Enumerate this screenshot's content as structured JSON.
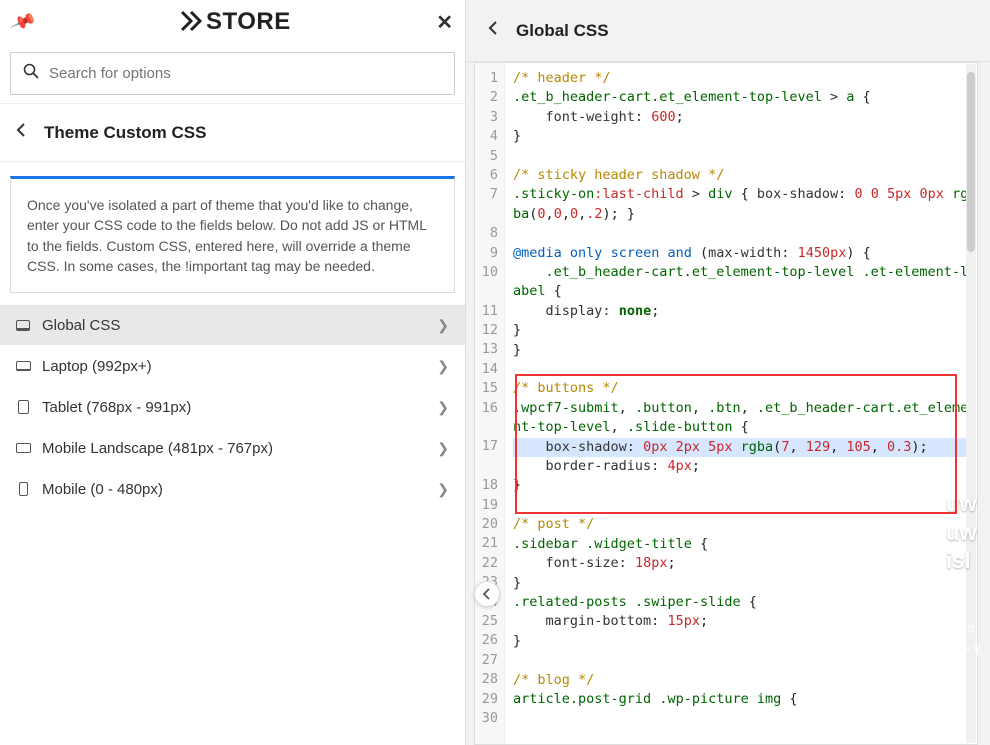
{
  "header": {
    "logo_prefix": "X",
    "logo_text": "STORE"
  },
  "search": {
    "placeholder": "Search for options"
  },
  "title": "Theme Custom CSS",
  "hint": "Once you've isolated a part of theme that you'd like to change, enter your CSS code to the fields below. Do not add JS or HTML to the fields. Custom CSS, entered here, will override a theme CSS. In some cases, the !important tag may be needed.",
  "menu": [
    {
      "label": "Global CSS",
      "active": true
    },
    {
      "label": "Laptop (992px+)",
      "active": false
    },
    {
      "label": "Tablet (768px - 991px)",
      "active": false
    },
    {
      "label": "Mobile Landscape (481px - 767px)",
      "active": false
    },
    {
      "label": "Mobile (0 - 480px)",
      "active": false
    }
  ],
  "right_title": "Global CSS",
  "code_lines": [
    {
      "n": 1,
      "html": "<span class='cm'>/* header */</span>"
    },
    {
      "n": 2,
      "html": "<span class='sel'>.et_b_header-cart.et_element-top-level</span> <span class='op'>&gt;</span> <span class='sel'>a</span> {"
    },
    {
      "n": 3,
      "html": "    <span class='prop'>font-weight:</span> <span class='num'>600</span>;"
    },
    {
      "n": 4,
      "html": "}"
    },
    {
      "n": 5,
      "html": ""
    },
    {
      "n": 6,
      "html": "<span class='cm'>/* sticky header shadow */</span>"
    },
    {
      "n": 7,
      "html": "<span class='sel'>.sticky-on</span><span class='pc'>:last-child</span> <span class='op'>&gt;</span> <span class='sel'>div</span> { <span class='prop'>box-shadow:</span> <span class='num'>0</span> <span class='num'>0</span> <span class='num'>5px</span> <span class='num'>0px</span> <span class='fn'>rgba</span>(<span class='num'>0</span>,<span class='num'>0</span>,<span class='num'>0</span>,<span class='num'>.2</span>); }"
    },
    {
      "n": 8,
      "html": ""
    },
    {
      "n": 9,
      "html": "<span class='at'>@media</span> <span class='kw'>only</span> <span class='kw'>screen</span> <span class='kw'>and</span> (<span class='prop'>max-width:</span> <span class='num'>1450px</span>) {"
    },
    {
      "n": 10,
      "html": "    <span class='sel'>.et_b_header-cart.et_element-top-level</span> <span class='sel'>.et-element-label</span> {"
    },
    {
      "n": 11,
      "html": "    <span class='prop'>display:</span> <span class='val'>none</span>;"
    },
    {
      "n": 12,
      "html": "}"
    },
    {
      "n": 13,
      "html": "}"
    },
    {
      "n": 14,
      "html": ""
    },
    {
      "n": 15,
      "html": "<span class='cm'>/* buttons */</span>"
    },
    {
      "n": 16,
      "html": "<span class='sel'>.wpcf7-submit</span>, <span class='sel'>.button</span>, <span class='sel'>.btn</span>, <span class='sel'>.et_b_header-cart.et_element-top-level</span>, <span class='sel'>.slide-button</span> {"
    },
    {
      "n": 17,
      "hl": true,
      "html": "    <span class='prop'>box-shadow:</span> <span class='num'>0px</span> <span class='num'>2px</span> <span class='num'>5px</span> <span class='fn'>rgba</span>(<span class='num'>7</span>, <span class='num'>129</span>, <span class='num'>105</span>, <span class='num'>0.3</span>);"
    },
    {
      "n": 18,
      "html": "    <span class='prop'>border-radius:</span> <span class='num'>4px</span>;"
    },
    {
      "n": 19,
      "html": "}"
    },
    {
      "n": 20,
      "html": ""
    },
    {
      "n": 21,
      "html": "<span class='cm'>/* post */</span>"
    },
    {
      "n": 22,
      "html": "<span class='sel'>.sidebar</span> <span class='sel'>.widget-title</span> {"
    },
    {
      "n": 23,
      "html": "    <span class='prop'>font-size:</span> <span class='num'>18px</span>;"
    },
    {
      "n": 24,
      "html": "}"
    },
    {
      "n": 25,
      "html": "<span class='sel'>.related-posts</span> <span class='sel'>.swiper-slide</span> {"
    },
    {
      "n": 26,
      "html": "    <span class='prop'>margin-bottom:</span> <span class='num'>15px</span>;"
    },
    {
      "n": 27,
      "html": "}"
    },
    {
      "n": 28,
      "html": ""
    },
    {
      "n": 29,
      "html": "<span class='cm'>/* blog */</span>"
    },
    {
      "n": 30,
      "html": "<span class='sel'>article.post-grid</span> <span class='sel'>.wp-picture</span> <span class='sel'>img</span> {"
    }
  ],
  "bg_frag1": "uw\nuw\nisl",
  "bg_frag2": "de id\nloos\nij Sp"
}
